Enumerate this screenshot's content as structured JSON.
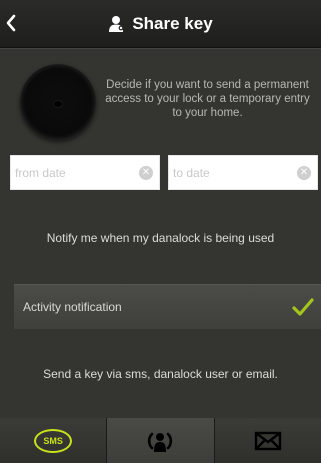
{
  "header": {
    "back_icon": "chevron-left-icon",
    "title_icon": "user-key-icon",
    "title": "Share key"
  },
  "intro": {
    "icon": "lock-knob-icon",
    "text": "Decide if you want to send a permanent access to your lock or a temporary entry to your home."
  },
  "dates": {
    "from_placeholder": "from date",
    "from_value": "",
    "to_placeholder": "to date",
    "to_value": ""
  },
  "notify": {
    "text": "Notify me when my danalock is being used"
  },
  "activity": {
    "label": "Activity notification",
    "checked": true,
    "check_color": "#a4c51b"
  },
  "send": {
    "text": "Send a key via sms, danalock user or email."
  },
  "tabs": [
    {
      "name": "sms",
      "label": "SMS",
      "icon": "sms-icon",
      "active_color": "#c8e21b"
    },
    {
      "name": "danalock-user",
      "icon": "danalock-user-icon"
    },
    {
      "name": "email",
      "icon": "envelope-icon"
    }
  ]
}
